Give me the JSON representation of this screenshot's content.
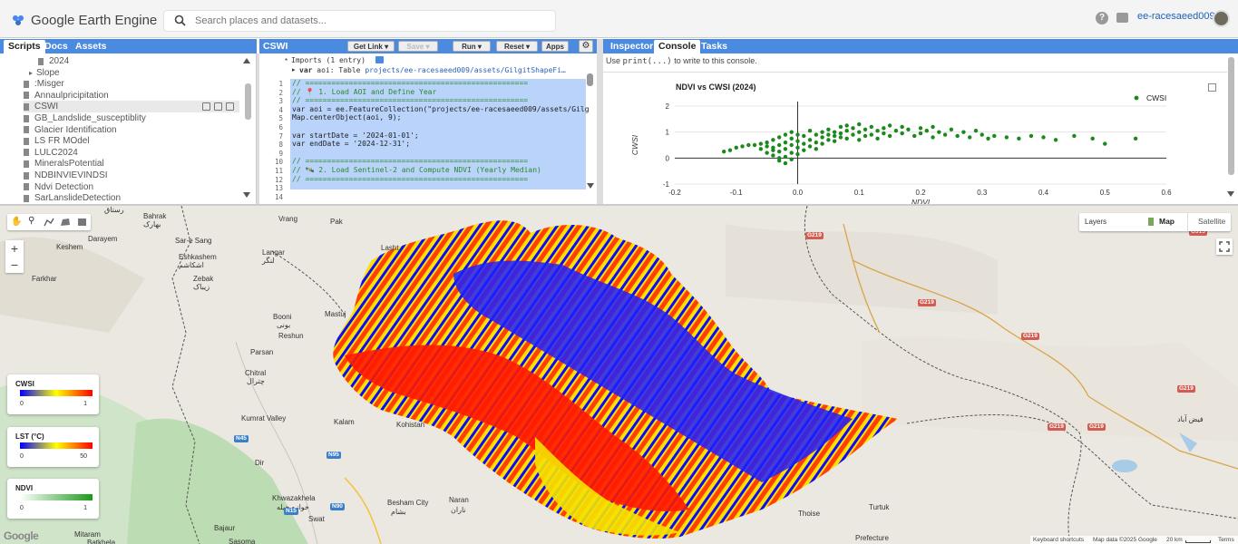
{
  "header": {
    "app_title": "Google Earth Engine",
    "search_placeholder": "Search places and datasets...",
    "help_glyph": "?",
    "user": "ee-racesaeed009"
  },
  "left_panel": {
    "tabs": [
      "Scripts",
      "Docs",
      "Assets"
    ],
    "items": [
      {
        "label": "2024",
        "type": "file",
        "indent": 2
      },
      {
        "label": "Slope",
        "type": "folder",
        "indent": 1
      },
      {
        "label": ":Misger",
        "type": "file",
        "indent": 1
      },
      {
        "label": "Annaulpricipitation",
        "type": "file",
        "indent": 1
      },
      {
        "label": "CSWI",
        "type": "file",
        "indent": 1,
        "selected": true
      },
      {
        "label": "GB_Landslide_susceptiblity",
        "type": "file",
        "indent": 1
      },
      {
        "label": "Glacier Identification",
        "type": "file",
        "indent": 1
      },
      {
        "label": "LS FR MOdel",
        "type": "file",
        "indent": 1
      },
      {
        "label": "LULC2024",
        "type": "file",
        "indent": 1
      },
      {
        "label": "MineralsPotential",
        "type": "file",
        "indent": 1
      },
      {
        "label": "NDBINVIEVINDSI",
        "type": "file",
        "indent": 1
      },
      {
        "label": "Ndvi Detection",
        "type": "file",
        "indent": 1
      },
      {
        "label": "SarLanslideDetection",
        "type": "file",
        "indent": 1
      }
    ]
  },
  "editor": {
    "title": "CSWI",
    "buttons": {
      "get_link": "Get Link",
      "save": "Save",
      "run": "Run",
      "reset": "Reset",
      "apps": "Apps"
    },
    "imports_header": "Imports (1 entry)",
    "import_line": {
      "kw": "var",
      "name": "aoi",
      "sep": ":",
      "type": "Table",
      "path": "projects/ee-racesaeed009/assets/GilgitShapeFi…"
    },
    "line_numbers": [
      "1",
      "2",
      "3",
      "4",
      "5",
      "6",
      "7",
      "8",
      "9",
      "10",
      "11",
      "12",
      "13",
      "14"
    ],
    "lines": [
      "// ===================================================",
      "// 📍 1. Load AOI and Define Year",
      "// ===================================================",
      "var aoi = ee.FeatureCollection(\"projects/ee-racesaeed009/assets/Gilg",
      "Map.centerObject(aoi, 9);",
      "",
      "var startDate = '2024-01-01';",
      "var endDate = '2024-12-31';",
      "",
      "// ===================================================",
      "// 🛰️ 2. Load Sentinel-2 and Compute NDVI (Yearly Median)",
      "// ==================================================="
    ]
  },
  "right_panel": {
    "tabs": [
      "Inspector",
      "Console",
      "Tasks"
    ],
    "hint_pre": "Use ",
    "hint_code": "print(...)",
    "hint_post": " to write to this console."
  },
  "chart_data": {
    "type": "scatter",
    "title": "NDVI vs CWSI (2024)",
    "xlabel": "NDVI",
    "ylabel": "CWSI",
    "xlim": [
      -0.2,
      0.6
    ],
    "ylim": [
      -1,
      2
    ],
    "x_ticks": [
      "-0.2",
      "-0.1",
      "0.0",
      "0.1",
      "0.2",
      "0.3",
      "0.4",
      "0.5",
      "0.6"
    ],
    "y_ticks": [
      "2",
      "1",
      "0",
      "-1"
    ],
    "legend": {
      "position": "top-right",
      "label": "CWSI"
    },
    "color": "#1b8a1b",
    "series": [
      {
        "name": "CWSI",
        "points": [
          [
            -0.12,
            0.25
          ],
          [
            -0.11,
            0.3
          ],
          [
            -0.1,
            0.4
          ],
          [
            -0.09,
            0.45
          ],
          [
            -0.08,
            0.5
          ],
          [
            -0.07,
            0.5
          ],
          [
            -0.06,
            0.55
          ],
          [
            -0.06,
            0.35
          ],
          [
            -0.05,
            0.6
          ],
          [
            -0.05,
            0.2
          ],
          [
            -0.05,
            0.45
          ],
          [
            -0.04,
            0.1
          ],
          [
            -0.04,
            0.4
          ],
          [
            -0.04,
            0.7
          ],
          [
            -0.04,
            0.3
          ],
          [
            -0.03,
            0.0
          ],
          [
            -0.03,
            0.5
          ],
          [
            -0.03,
            0.8
          ],
          [
            -0.03,
            0.25
          ],
          [
            -0.03,
            -0.1
          ],
          [
            -0.02,
            0.6
          ],
          [
            -0.02,
            0.35
          ],
          [
            -0.02,
            0.9
          ],
          [
            -0.02,
            0.05
          ],
          [
            -0.02,
            -0.2
          ],
          [
            -0.01,
            0.5
          ],
          [
            -0.01,
            0.75
          ],
          [
            -0.01,
            0.2
          ],
          [
            -0.01,
            1.0
          ],
          [
            -0.01,
            -0.05
          ],
          [
            0.0,
            0.4
          ],
          [
            0.0,
            0.65
          ],
          [
            0.0,
            0.15
          ],
          [
            0.0,
            0.9
          ],
          [
            0.01,
            0.55
          ],
          [
            0.01,
            0.3
          ],
          [
            0.01,
            0.85
          ],
          [
            0.02,
            0.45
          ],
          [
            0.02,
            0.7
          ],
          [
            0.02,
            1.05
          ],
          [
            0.03,
            0.6
          ],
          [
            0.03,
            0.9
          ],
          [
            0.03,
            0.35
          ],
          [
            0.04,
            0.8
          ],
          [
            0.04,
            1.0
          ],
          [
            0.04,
            0.55
          ],
          [
            0.05,
            0.7
          ],
          [
            0.05,
            1.1
          ],
          [
            0.05,
            0.9
          ],
          [
            0.06,
            0.65
          ],
          [
            0.06,
            1.0
          ],
          [
            0.06,
            0.85
          ],
          [
            0.07,
            1.2
          ],
          [
            0.07,
            0.8
          ],
          [
            0.07,
            0.95
          ],
          [
            0.08,
            1.05
          ],
          [
            0.08,
            0.75
          ],
          [
            0.08,
            1.25
          ],
          [
            0.09,
            0.9
          ],
          [
            0.09,
            1.15
          ],
          [
            0.1,
            1.0
          ],
          [
            0.1,
            0.7
          ],
          [
            0.1,
            1.3
          ],
          [
            0.11,
            0.85
          ],
          [
            0.11,
            1.1
          ],
          [
            0.12,
            1.2
          ],
          [
            0.12,
            0.9
          ],
          [
            0.13,
            1.05
          ],
          [
            0.13,
            0.75
          ],
          [
            0.14,
            1.15
          ],
          [
            0.14,
            0.95
          ],
          [
            0.15,
            1.25
          ],
          [
            0.15,
            0.85
          ],
          [
            0.16,
            1.05
          ],
          [
            0.17,
            0.95
          ],
          [
            0.17,
            1.2
          ],
          [
            0.18,
            1.1
          ],
          [
            0.19,
            0.85
          ],
          [
            0.2,
            1.15
          ],
          [
            0.2,
            0.95
          ],
          [
            0.21,
            1.05
          ],
          [
            0.22,
            0.8
          ],
          [
            0.22,
            1.2
          ],
          [
            0.23,
            1.0
          ],
          [
            0.24,
            0.9
          ],
          [
            0.25,
            1.1
          ],
          [
            0.26,
            0.85
          ],
          [
            0.27,
            1.0
          ],
          [
            0.28,
            0.8
          ],
          [
            0.29,
            1.05
          ],
          [
            0.3,
            0.9
          ],
          [
            0.31,
            0.75
          ],
          [
            0.32,
            0.85
          ],
          [
            0.34,
            0.8
          ],
          [
            0.36,
            0.75
          ],
          [
            0.38,
            0.85
          ],
          [
            0.4,
            0.8
          ],
          [
            0.42,
            0.7
          ],
          [
            0.45,
            0.85
          ],
          [
            0.48,
            0.75
          ],
          [
            0.5,
            0.55
          ],
          [
            0.55,
            0.75
          ]
        ]
      }
    ]
  },
  "map": {
    "toolbar_icons": [
      "hand-icon",
      "marker-icon",
      "polyline-icon",
      "polygon-icon",
      "rectangle-icon"
    ],
    "zoom_in": "+",
    "zoom_out": "−",
    "layers_label": "Layers",
    "map_type_map": "Map",
    "map_type_satellite": "Satellite",
    "labels": [
      "Vrang",
      "Pak",
      "Bahrak",
      "بهارک",
      "Sar-e Sang",
      "Darayem",
      "Keshem",
      "Eshkashem",
      "اشکاشم",
      "Langar",
      "لنگر",
      "Lasht",
      "Farkhar",
      "Zebak",
      "زیباک",
      "Mastuj",
      "Booni",
      "بونی",
      "Reshun",
      "Parsan",
      "Chitral",
      "چترال",
      "Kumrat Valley",
      "Kalam",
      "Kohistan",
      "Dir",
      "Khwazakhela",
      "خوازه خیله",
      "Besham City",
      "بشام",
      "Swat",
      "Naran",
      "ناران",
      "Bajaur",
      "Mitaram",
      "Batkhela",
      "Sasoma",
      "Turtuk",
      "Thoise",
      "Prefecture",
      "فیض آباد",
      "رستاق"
    ],
    "label_positions_note": "",
    "road_shields": [
      "G219",
      "G219",
      "G219",
      "G219",
      "G219",
      "G219",
      "G315"
    ],
    "national_shields": [
      "N45",
      "N95",
      "N90",
      "N15",
      "N45"
    ],
    "legends": [
      {
        "title": "CWSI",
        "min": "0",
        "max": "1",
        "gradient": [
          "#0000ff",
          "#ffff00",
          "#ff0000"
        ]
      },
      {
        "title": "LST (°C)",
        "min": "0",
        "max": "50",
        "gradient": [
          "#0000ff",
          "#ffff00",
          "#ff0000"
        ]
      },
      {
        "title": "NDVI",
        "min": "0",
        "max": "1",
        "gradient": [
          "#ffffff",
          "#1a9a1a"
        ]
      }
    ],
    "attribution": {
      "shortcuts": "Keyboard shortcuts",
      "data": "Map data ©2025 Google",
      "scale": "20 km",
      "terms": "Terms"
    },
    "google_mark": "Google"
  }
}
